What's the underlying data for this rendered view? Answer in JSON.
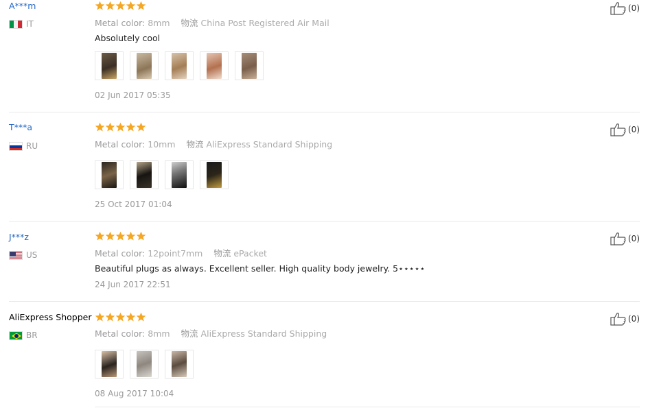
{
  "labels": {
    "metal_color": "Metal color:",
    "shipping": "物流"
  },
  "reviews": [
    {
      "user": "A***m",
      "country": "IT",
      "metal_color": "8mm",
      "shipping": "China Post Registered Air Mail",
      "feedback": "Absolutely cool",
      "date": "02 Jun 2017 05:35",
      "likes": "(0)"
    },
    {
      "user": "T***a",
      "country": "RU",
      "metal_color": "10mm",
      "shipping": "AliExpress Standard Shipping",
      "feedback": "",
      "date": "25 Oct 2017 01:04",
      "likes": "(0)"
    },
    {
      "user": "J***z",
      "country": "US",
      "metal_color": "12point7mm",
      "shipping": "ePacket",
      "feedback": "Beautiful plugs as always. Excellent seller. High quality body jewelry. 5⋆⋆⋆⋆⋆",
      "date": "24 Jun 2017 22:51",
      "likes": "(0)"
    },
    {
      "user": "AliExpress Shopper",
      "country": "BR",
      "metal_color": "8mm",
      "shipping": "AliExpress Standard Shipping",
      "feedback": "",
      "date": "08 Aug 2017 10:04",
      "likes": "(0)"
    }
  ],
  "colors": {
    "star": "#f5a623",
    "link": "#2569c6"
  },
  "icons": [
    "star-icon",
    "thumbs-up-icon",
    "flag-icon"
  ]
}
